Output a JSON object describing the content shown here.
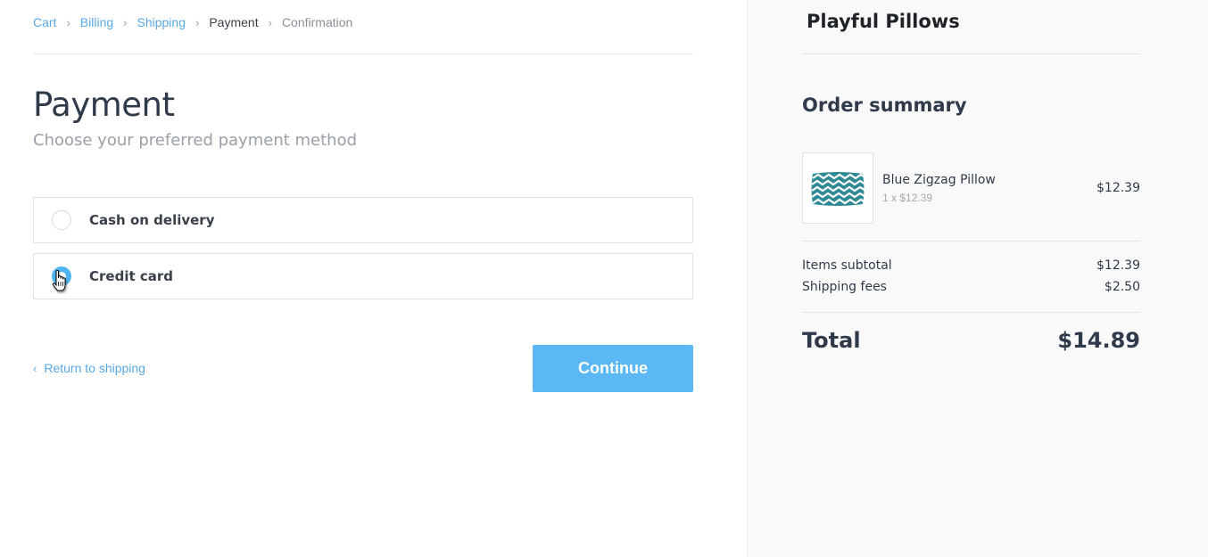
{
  "breadcrumb": {
    "items": [
      {
        "label": "Cart",
        "state": "link"
      },
      {
        "label": "Billing",
        "state": "link"
      },
      {
        "label": "Shipping",
        "state": "link"
      },
      {
        "label": "Payment",
        "state": "current"
      },
      {
        "label": "Confirmation",
        "state": "upcoming"
      }
    ],
    "separator": "›"
  },
  "main": {
    "title": "Payment",
    "subtitle": "Choose your preferred payment method",
    "options": [
      {
        "label": "Cash on delivery",
        "selected": false
      },
      {
        "label": "Credit card",
        "selected": true
      }
    ],
    "return_link": {
      "chevron": "‹",
      "label": "Return to shipping"
    },
    "continue_label": "Continue"
  },
  "sidebar": {
    "brand": "Playful Pillows",
    "summary_title": "Order summary",
    "item": {
      "name": "Blue Zigzag Pillow",
      "quantity_line": "1 x $12.39",
      "price": "$12.39",
      "thumbnail_icon": "zigzag-pillow-image"
    },
    "subtotal": {
      "label": "Items subtotal",
      "value": "$12.39"
    },
    "shipping": {
      "label": "Shipping fees",
      "value": "$2.50"
    },
    "total": {
      "label": "Total",
      "value": "$14.89"
    }
  },
  "colors": {
    "accent": "#5bb8f4",
    "link": "#5aa9e2",
    "text": "#2f3a4a",
    "muted": "#9aa0a6",
    "sidebar_bg": "#f9f9f9"
  }
}
